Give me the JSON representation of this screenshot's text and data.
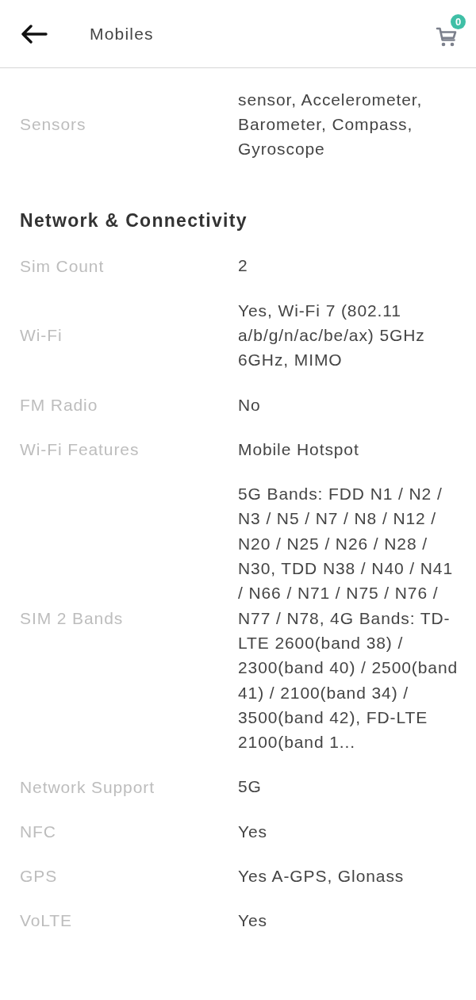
{
  "header": {
    "title": "Mobiles",
    "cart_count": "0"
  },
  "sections": [
    {
      "rows": [
        {
          "label": "Sensors",
          "value": "sensor, Accelerometer, Barometer, Compass, Gyroscope"
        }
      ]
    },
    {
      "title": "Network & Connectivity",
      "rows": [
        {
          "label": "Sim Count",
          "value": "2"
        },
        {
          "label": "Wi-Fi",
          "value": "Yes, Wi-Fi 7 (802.11 a/b/g/n/ac/be/ax) 5GHz 6GHz, MIMO"
        },
        {
          "label": "FM Radio",
          "value": "No"
        },
        {
          "label": "Wi-Fi Features",
          "value": "Mobile Hotspot"
        },
        {
          "label": "SIM 2 Bands",
          "value": "5G Bands: FDD N1 / N2 / N3 / N5 / N7 / N8 / N12 / N20 / N25 / N26 / N28 / N30, TDD N38 / N40 / N41 / N66 / N71 / N75 / N76 / N77 / N78, 4G Bands: TD-LTE 2600(band 38) / 2300(band 40) / 2500(band 41) / 2100(band 34) / 3500(band 42), FD-LTE 2100(band 1..."
        },
        {
          "label": "Network Support",
          "value": "5G"
        },
        {
          "label": "NFC",
          "value": "Yes"
        },
        {
          "label": "GPS",
          "value": "Yes A-GPS, Glonass"
        },
        {
          "label": "VoLTE",
          "value": "Yes"
        }
      ]
    }
  ]
}
